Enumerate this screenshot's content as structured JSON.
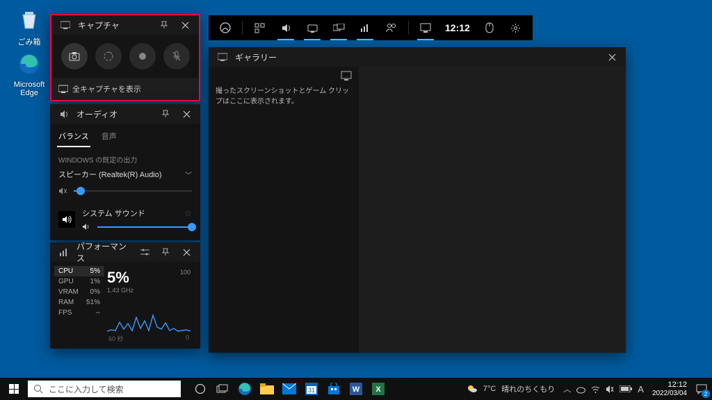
{
  "desktop": {
    "icons": [
      {
        "label": "ごみ箱"
      },
      {
        "label": "Microsoft Edge"
      }
    ]
  },
  "gamebar": {
    "time": "12:12"
  },
  "capture": {
    "title": "キャプチャ",
    "footer": "全キャプチャを表示"
  },
  "audio": {
    "title": "オーディオ",
    "tabs": {
      "balance": "バランス",
      "voice": "音声"
    },
    "default_output_caption": "WINDOWS の既定の出力",
    "device": "スピーカー (Realtek(R) Audio)",
    "device_volume_pct": 6,
    "system_sound_label": "システム サウンド",
    "system_volume_pct": 100
  },
  "perf": {
    "title": "パフォーマンス",
    "stats": [
      {
        "label": "CPU",
        "value": "5%"
      },
      {
        "label": "GPU",
        "value": "1%"
      },
      {
        "label": "VRAM",
        "value": "0%"
      },
      {
        "label": "RAM",
        "value": "51%"
      },
      {
        "label": "FPS",
        "value": "--"
      }
    ],
    "big": "5%",
    "sub": "1.43 GHz",
    "y_max": "100",
    "y_min": "0",
    "x_label": "60 秒"
  },
  "gallery": {
    "title": "ギャラリー",
    "empty_msg": "撮ったスクリーンショットとゲーム クリップはここに表示されます。"
  },
  "taskbar": {
    "search_placeholder": "ここに入力して検索",
    "weather_temp": "7°C",
    "weather_text": "晴れのちくもり",
    "ime": "A",
    "time": "12:12",
    "date": "2022/03/04",
    "notif_count": "2"
  },
  "chart_data": {
    "type": "line",
    "title": "CPU",
    "xlabel": "60 秒",
    "ylabel": "%",
    "ylim": [
      0,
      100
    ],
    "x": [
      0,
      3,
      6,
      9,
      12,
      15,
      18,
      21,
      24,
      27,
      30,
      33,
      36,
      39,
      42,
      45,
      48,
      51,
      54,
      57,
      60
    ],
    "values": [
      4,
      6,
      5,
      26,
      8,
      20,
      6,
      38,
      10,
      28,
      6,
      42,
      14,
      8,
      24,
      6,
      10,
      5,
      6,
      7,
      5
    ]
  }
}
